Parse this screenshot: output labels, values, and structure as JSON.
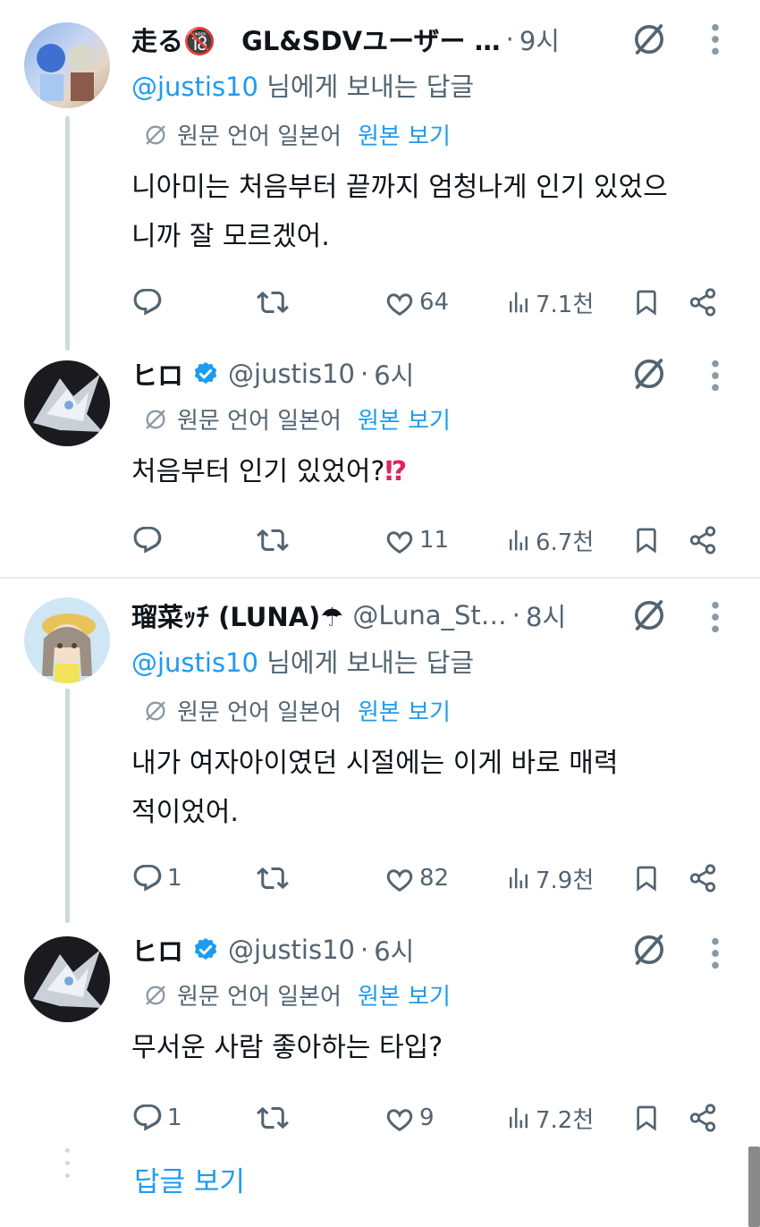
{
  "tweets": [
    {
      "name": "走る🔞　GL&SDVユーザー …",
      "handle": "",
      "time": "9시",
      "reply_to_mention": "@justis10",
      "reply_to_suffix": " 님에게 보내는 답글",
      "translate_note": "원문 언어 일본어",
      "show_original": "원본 보기",
      "text": "니아미는 처음부터 끝까지 엄청나게 인기 있었으니까 잘 모르겠어.",
      "replies": "",
      "likes": "64",
      "views": "7.1천"
    },
    {
      "name": "ヒロ",
      "handle": "@justis10",
      "time": "6시",
      "translate_note": "원문 언어 일본어",
      "show_original": "원본 보기",
      "text": "처음부터 인기 있었어?",
      "text_emoji": "⁉",
      "replies": "",
      "likes": "11",
      "views": "6.7천"
    },
    {
      "name": "瑠菜ｯﾁ (LUNA)☂",
      "handle": "@Luna_St…",
      "time": "8시",
      "reply_to_mention": "@justis10",
      "reply_to_suffix": " 님에게 보내는 답글",
      "translate_note": "원문 언어 일본어",
      "show_original": "원본 보기",
      "text": "내가 여자아이였던 시절에는 이게 바로 매력적이었어.",
      "replies": "1",
      "likes": "82",
      "views": "7.9천"
    },
    {
      "name": "ヒロ",
      "handle": "@justis10",
      "time": "6시",
      "translate_note": "원문 언어 일본어",
      "show_original": "원본 보기",
      "text": "무서운 사람 좋아하는 타입?",
      "replies": "1",
      "likes": "9",
      "views": "7.2천"
    }
  ],
  "separator": "·",
  "show_replies_label": "답글 보기",
  "colors": {
    "text": "#0f1419",
    "secondary": "#536471",
    "link": "#1d9bf0",
    "thread_line": "#cfd9de",
    "verified": "#1d9bf0"
  },
  "icons": [
    "reply-icon",
    "retweet-icon",
    "like-icon",
    "views-icon",
    "bookmark-icon",
    "share-icon",
    "grok-icon",
    "more-icon",
    "verified-badge-icon",
    "translate-icon"
  ]
}
